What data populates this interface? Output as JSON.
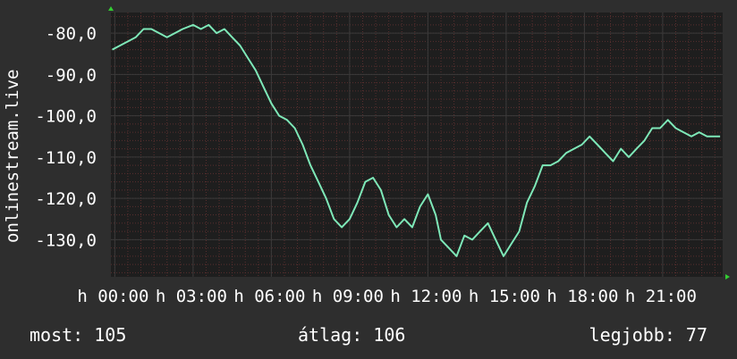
{
  "chart_data": {
    "type": "line",
    "ylabel": "onlinestream.live",
    "ylim": [
      -139,
      -75
    ],
    "yticks": [
      -80,
      -90,
      -100,
      -110,
      -120,
      -130
    ],
    "ytick_labels": [
      "-80,0",
      "-90,0",
      "-100,0",
      "-110,0",
      "-120,0",
      "-130,0"
    ],
    "xlim": [
      -0.15,
      23.3
    ],
    "xticks": [
      0,
      3,
      6,
      9,
      12,
      15,
      18,
      21
    ],
    "xtick_labels": [
      "h 00:00",
      "h 03:00",
      "h 06:00",
      "h 09:00",
      "h 12:00",
      "h 15:00",
      "h 18:00",
      "h 21:00"
    ],
    "grid": true,
    "colors": {
      "background": "#2e2e2e",
      "plot_background": "#1e1e1e",
      "grid": "#3a3a3a",
      "minor_grid": "#5a2f2f",
      "line": "#7ee8b8",
      "axis_marker": "#33cc33"
    },
    "series": [
      {
        "x": [
          -0.1,
          0.2,
          0.5,
          0.8,
          1.1,
          1.4,
          1.7,
          2.0,
          2.3,
          2.6,
          3.0,
          3.3,
          3.6,
          3.9,
          4.2,
          4.5,
          4.8,
          5.1,
          5.4,
          5.7,
          6.0,
          6.3,
          6.6,
          6.9,
          7.2,
          7.5,
          7.8,
          8.1,
          8.4,
          8.7,
          9.0,
          9.3,
          9.6,
          9.9,
          10.2,
          10.5,
          10.8,
          11.1,
          11.4,
          11.7,
          12.0,
          12.3,
          12.5,
          12.8,
          13.1,
          13.4,
          13.7,
          14.0,
          14.3,
          14.6,
          14.9,
          15.2,
          15.5,
          15.8,
          16.1,
          16.4,
          16.7,
          17.0,
          17.3,
          17.6,
          17.9,
          18.2,
          18.5,
          18.8,
          19.1,
          19.4,
          19.7,
          20.0,
          20.3,
          20.6,
          20.9,
          21.2,
          21.5,
          21.8,
          22.1,
          22.4,
          22.7,
          23.0,
          23.2
        ],
        "y": [
          -84,
          -83,
          -82,
          -81,
          -79,
          -79,
          -80,
          -81,
          -80,
          -79,
          -78,
          -79,
          -78,
          -80,
          -79,
          -81,
          -83,
          -86,
          -89,
          -93,
          -97,
          -100,
          -101,
          -103,
          -107,
          -112,
          -116,
          -120,
          -125,
          -127,
          -125,
          -121,
          -116,
          -115,
          -118,
          -124,
          -127,
          -125,
          -127,
          -122,
          -119,
          -124,
          -130,
          -132,
          -134,
          -129,
          -130,
          -128,
          -126,
          -130,
          -134,
          -131,
          -128,
          -121,
          -117,
          -112,
          -112,
          -111,
          -109,
          -108,
          -107,
          -105,
          -107,
          -109,
          -111,
          -108,
          -110,
          -108,
          -106,
          -103,
          -103,
          -101,
          -103,
          -104,
          -105,
          -104,
          -105,
          -105,
          -105
        ]
      }
    ]
  },
  "footer": {
    "current": "most: 105",
    "average": "átlag: 106",
    "best": "legjobb: 77"
  }
}
